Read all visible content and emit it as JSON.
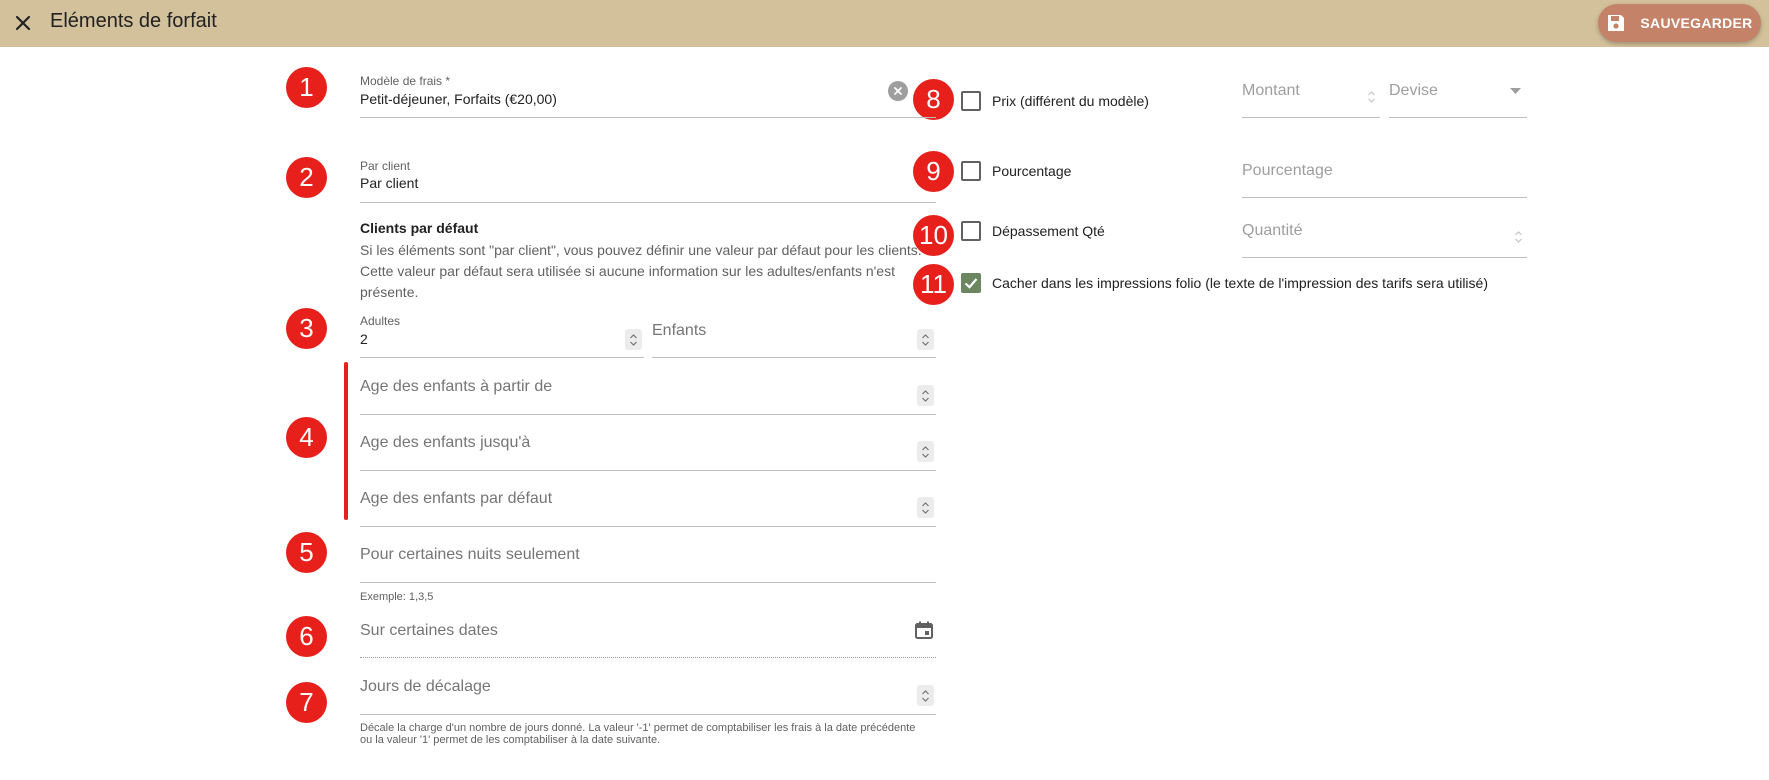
{
  "header": {
    "title": "Eléments de forfait",
    "save_label": "SAUVEGARDER"
  },
  "colors": {
    "header_bg": "#d3c19b",
    "save_bg": "#c48268",
    "badge": "#e8201c",
    "checkbox_checked": "#6b8660"
  },
  "badges": [
    "1",
    "2",
    "3",
    "4",
    "5",
    "6",
    "7",
    "8",
    "9",
    "10",
    "11"
  ],
  "left": {
    "fee_model": {
      "label": "Modèle de frais *",
      "value": "Petit-déjeuner, Forfaits (€20,00)"
    },
    "per_client": {
      "label": "Par client",
      "value": "Par client"
    },
    "default_clients": {
      "title": "Clients par défaut",
      "description": "Si les éléments sont \"par client\", vous pouvez définir une valeur par défaut pour les clients. Cette valeur par défaut sera utilisée si aucune information sur les adultes/enfants n'est présente."
    },
    "adults": {
      "label": "Adultes",
      "value": "2"
    },
    "children": {
      "placeholder": "Enfants"
    },
    "child_age_from": {
      "placeholder": "Age des enfants à partir de"
    },
    "child_age_to": {
      "placeholder": "Age des enfants jusqu'à"
    },
    "child_age_default": {
      "placeholder": "Age des enfants par défaut"
    },
    "nights": {
      "placeholder": "Pour certaines nuits seulement",
      "hint": "Exemple: 1,3,5"
    },
    "dates": {
      "placeholder": "Sur certaines dates"
    },
    "offset": {
      "placeholder": "Jours de décalage",
      "hint": "Décale la charge d'un nombre de jours donné. La valeur '-1' permet de comptabiliser les frais à la date précédente ou la valeur '1' permet de les comptabiliser à la date suivante."
    }
  },
  "right": {
    "price": {
      "label": "Prix (différent du modèle)",
      "checked": false,
      "amount_placeholder": "Montant",
      "currency_placeholder": "Devise"
    },
    "percentage": {
      "label": "Pourcentage",
      "checked": false,
      "input_placeholder": "Pourcentage"
    },
    "qty_overflow": {
      "label": "Dépassement Qté",
      "checked": false,
      "input_placeholder": "Quantité"
    },
    "hide_folio": {
      "label": "Cacher dans les impressions folio (le texte de l'impression des tarifs sera utilisé)",
      "checked": true
    }
  }
}
